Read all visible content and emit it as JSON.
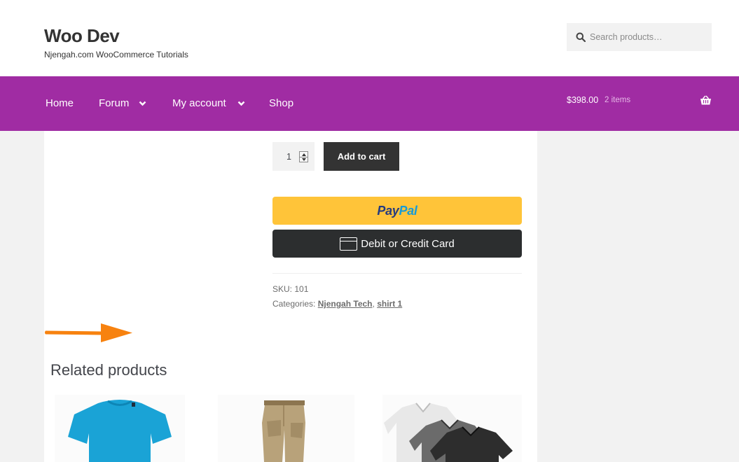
{
  "header": {
    "site_title": "Woo Dev",
    "tagline": "Njengah.com WooCommerce Tutorials",
    "search_placeholder": "Search products…"
  },
  "nav": {
    "items": [
      {
        "label": "Home",
        "has_dropdown": false
      },
      {
        "label": "Forum",
        "has_dropdown": true
      },
      {
        "label": "My account",
        "has_dropdown": true
      },
      {
        "label": "Shop",
        "has_dropdown": false
      }
    ],
    "cart_total": "$398.00",
    "cart_count": "2 items",
    "cart_icon": "basket-icon",
    "background": "#a02ca3"
  },
  "product": {
    "quantity": "1",
    "add_to_cart_label": "Add to cart",
    "paypal_pay": "Pay",
    "paypal_pal": "Pal",
    "card_button_label": "Debit or Credit Card",
    "sku_label": "SKU:",
    "sku_value": "101",
    "categories_label": "Categories:",
    "categories": [
      "Njengah Tech",
      "shirt 1"
    ]
  },
  "annotation": {
    "arrow_color": "#f7820f"
  },
  "related": {
    "title": "Related products",
    "items": [
      {
        "image": "blue-tshirt-image"
      },
      {
        "image": "khaki-pants-image"
      },
      {
        "image": "vneck-shirts-image"
      }
    ]
  }
}
